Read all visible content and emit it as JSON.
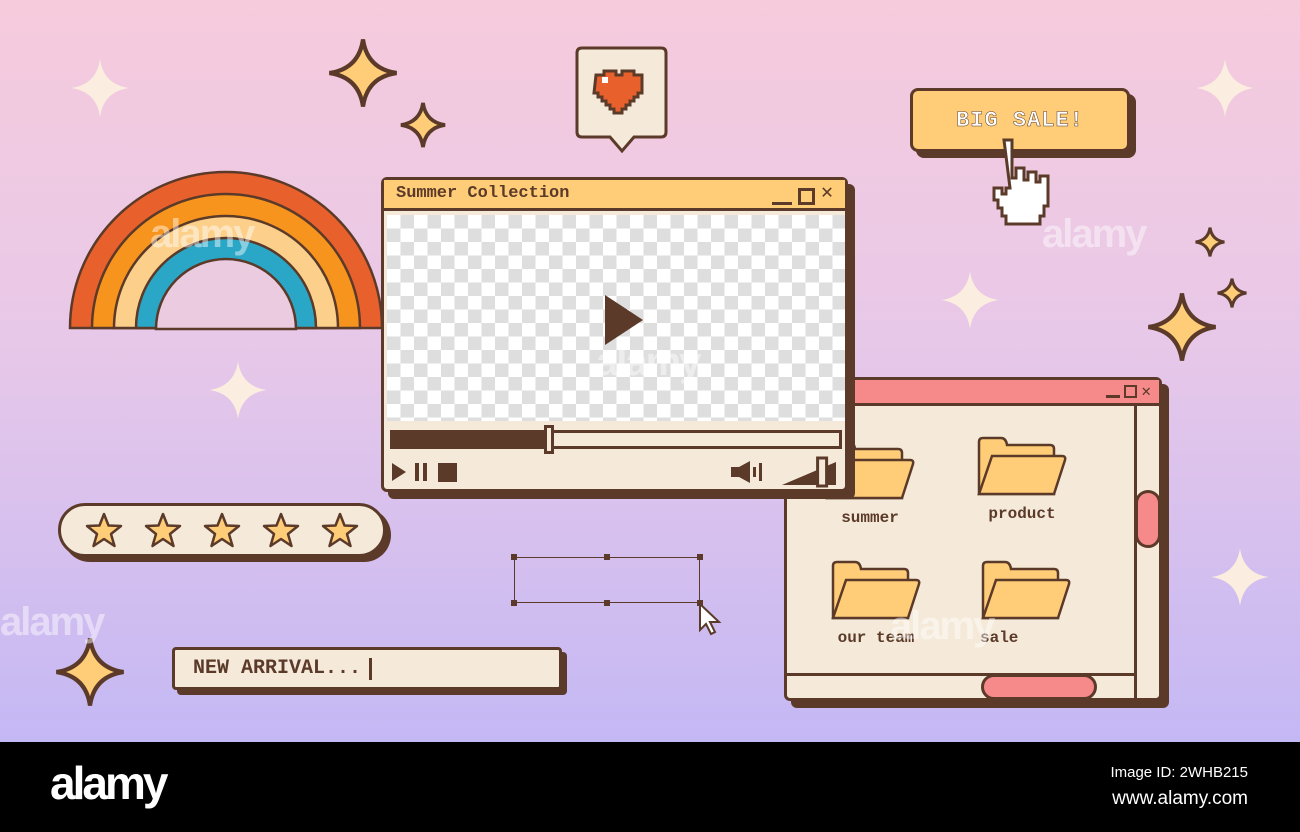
{
  "colors": {
    "outline": "#5b3a29",
    "yellow": "#ffcc77",
    "cream": "#f5ead9",
    "pink": "#f68a8a",
    "orange": "#e8612c"
  },
  "video_window": {
    "title": "Summer Collection",
    "progress_percent": 35,
    "volume_percent": 80,
    "icons": [
      "play-icon",
      "pause-icon",
      "stop-icon",
      "volume-icon",
      "minimize-icon",
      "maximize-icon",
      "close-icon"
    ]
  },
  "sale_button": {
    "label": "BIG SALE!"
  },
  "rating": {
    "stars": 5,
    "max": 5
  },
  "search_input": {
    "value": "NEW ARRIVAL..."
  },
  "file_window": {
    "folders": [
      {
        "label": "summer"
      },
      {
        "label": "product"
      },
      {
        "label": "our team"
      },
      {
        "label": "sale"
      }
    ]
  },
  "watermark": "alamy",
  "footer": {
    "logo": "alamy",
    "image_id": "Image ID: 2WHB215",
    "url": "www.alamy.com"
  }
}
